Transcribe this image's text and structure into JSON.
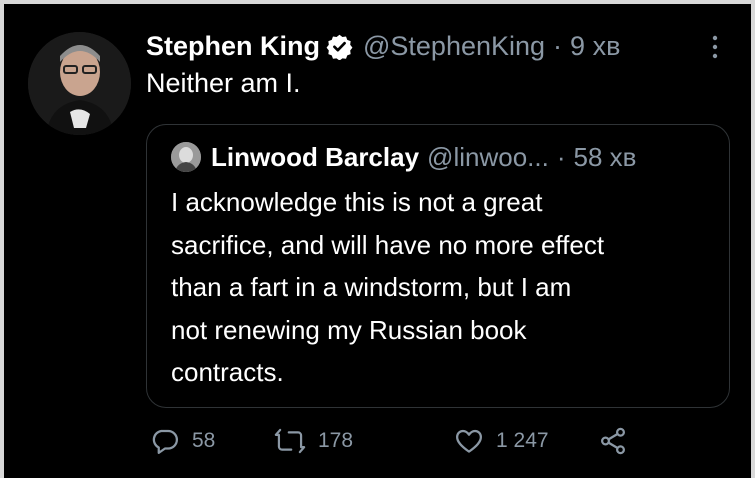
{
  "tweet": {
    "author_name": "Stephen King",
    "handle": "@StephenKing",
    "separator": "·",
    "time": "9 хв",
    "text": "Neither am I.",
    "verified_icon": "verified-badge-icon",
    "more_icon": "more-options-icon"
  },
  "quoted_tweet": {
    "author_name": "Linwood Barclay",
    "handle": "@linwoo...",
    "separator": "·",
    "time": "58 хв",
    "lines": [
      "I acknowledge this is not a great",
      "sacrifice, and will have no more effect",
      "than a fart in a windstorm, but I am",
      "not renewing my Russian book",
      "contracts."
    ]
  },
  "actions": {
    "reply_count": "58",
    "retweet_count": "178",
    "like_count": "1 247",
    "icons": [
      "reply-icon",
      "retweet-icon",
      "like-icon",
      "share-icon"
    ]
  },
  "colors": {
    "background": "#000000",
    "text": "#ffffff",
    "muted": "#8b98a5",
    "border": "#2f3336",
    "verified": "#ffffff"
  }
}
